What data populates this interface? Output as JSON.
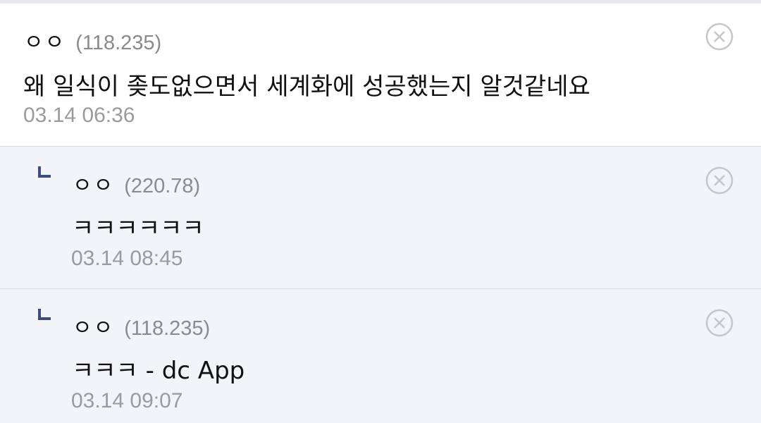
{
  "comments": [
    {
      "nickname": "ㅇㅇ",
      "ip": "(118.235)",
      "text": "왜 일식이 좆도없으면서 세계화에 성공했는지 알것같네요",
      "time": "03.14 06:36",
      "delete_icon": "close-circle-icon"
    },
    {
      "nickname": "ㅇㅇ",
      "ip": "(220.78)",
      "text": "ㅋㅋㅋㅋㅋㅋ",
      "time": "03.14 08:45",
      "delete_icon": "close-circle-icon"
    },
    {
      "nickname": "ㅇㅇ",
      "ip": "(118.235)",
      "text": "ㅋㅋㅋ - dc App",
      "time": "03.14 09:07",
      "delete_icon": "close-circle-icon"
    }
  ],
  "colors": {
    "reply_bg": "#f3f4f8",
    "reply_arrow": "#3d4b7d",
    "meta_gray": "#9a9a9f",
    "delete_icon": "#c4c6cc"
  }
}
